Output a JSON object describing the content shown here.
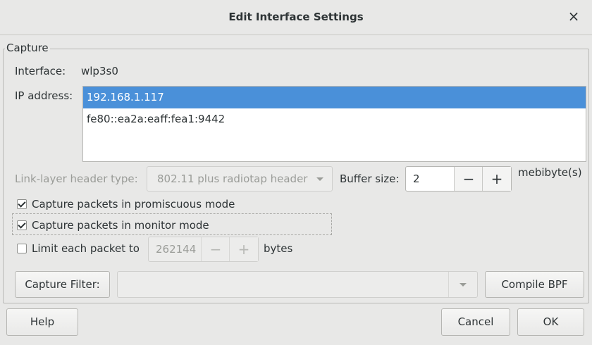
{
  "window": {
    "title": "Edit Interface Settings",
    "close_glyph": "×"
  },
  "capture": {
    "group_label": "Capture",
    "interface_label": "Interface:",
    "interface_value": "wlp3s0",
    "ip_label": "IP address:",
    "ip_addresses": [
      "192.168.1.117",
      "fe80::ea2a:eaff:fea1:9442"
    ],
    "link_layer_label": "Link-layer header type:",
    "link_layer_value": "802.11 plus radiotap header",
    "buffer_label": "Buffer size:",
    "buffer_value": "2",
    "buffer_unit": "mebibyte(s)",
    "promiscuous_label": "Capture packets in promiscuous mode",
    "promiscuous_checked": true,
    "monitor_label": "Capture packets in monitor mode",
    "monitor_checked": true,
    "limit_label": "Limit each packet to",
    "limit_checked": false,
    "limit_value": "262144",
    "limit_unit": "bytes",
    "capture_filter_button": "Capture Filter:",
    "capture_filter_value": "",
    "compile_bpf_button": "Compile BPF"
  },
  "footer": {
    "help": "Help",
    "cancel": "Cancel",
    "ok": "OK"
  },
  "spin_minus": "−",
  "spin_plus": "+",
  "colors": {
    "selection": "#4a90d9",
    "background": "#e8e8e7"
  }
}
